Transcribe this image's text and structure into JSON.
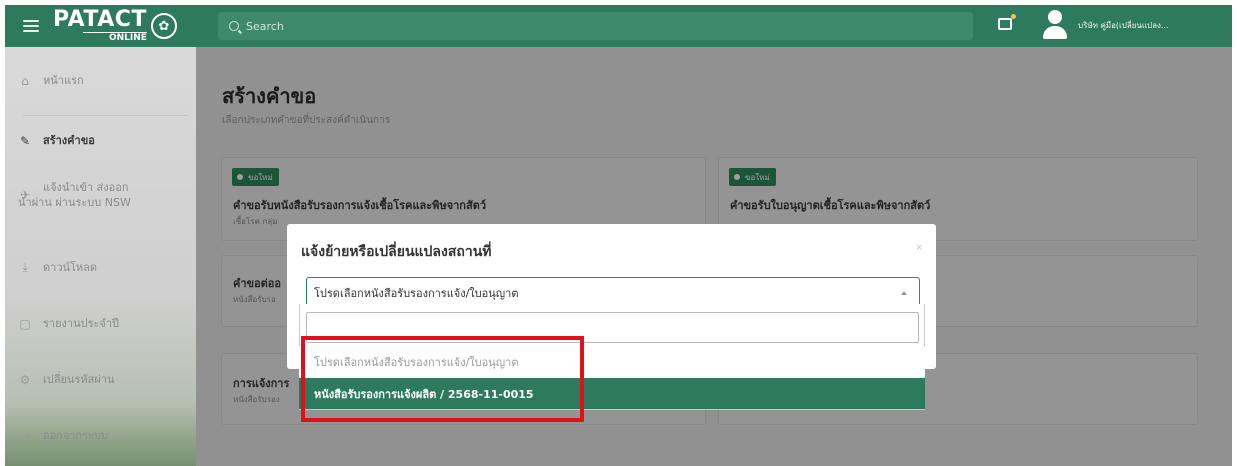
{
  "topbar": {
    "logo_main": "PATACT",
    "logo_sub": "ONLINE",
    "search_placeholder": "Search",
    "user_name": "บริษัท คู่มือ(เปลี่ยนแปลง..."
  },
  "sidebar": {
    "items": [
      {
        "label": "หน้าแรก",
        "icon": "home-icon"
      },
      {
        "label": "สร้างคำขอ",
        "icon": "pencil-icon"
      },
      {
        "label_line1": "แจ้งนำเข้า ส่งออก",
        "label_line2": "นำผ่าน ผ่านระบบ NSW",
        "icon": "plane-icon"
      },
      {
        "label": "ดาวน์โหลด",
        "icon": "download-icon"
      },
      {
        "label": "รายงานประจำปี",
        "icon": "document-icon"
      },
      {
        "label": "เปลี่ยนรหัสผ่าน",
        "icon": "gears-icon"
      },
      {
        "label": "ออกจากระบบ",
        "icon": "logout-icon"
      }
    ]
  },
  "main": {
    "title": "สร้างคำขอ",
    "subtitle": "เลือกประเภทคำขอที่ประสงค์ดำเนินการ",
    "cards": [
      {
        "badge": "ขอใหม่",
        "title": "คำขอรับหนังสือรับรองการแจ้งเชื้อโรคและพิษจากสัตว์",
        "sub": "เชื้อโรค กลุ่ม"
      },
      {
        "badge": "ขอใหม่",
        "title": "คำขอรับใบอนุญาตเชื้อโรคและพิษจากสัตว์",
        "sub": ""
      },
      {
        "title": "คำขอต่ออ",
        "sub": "หนังสือรับรอ"
      },
      {
        "title": "การแจ้งการ",
        "sub": "หนังสือรับรอง"
      }
    ]
  },
  "modal": {
    "title": "แจ้งย้ายหรือเปลี่ยนแปลงสถานที่",
    "close": "×",
    "select_value": "โปรดเลือกหนังสือรับรองการแจ้ง/ใบอนุญาต",
    "options": [
      "โปรดเลือกหนังสือรับรองการแจ้ง/ใบอนุญาต",
      "หนังสือรับรองการแจ้งผลิต / 2568-11-0015"
    ]
  },
  "colors": {
    "brand_green": "#2e7a5e",
    "highlight_red": "#e0101b"
  }
}
